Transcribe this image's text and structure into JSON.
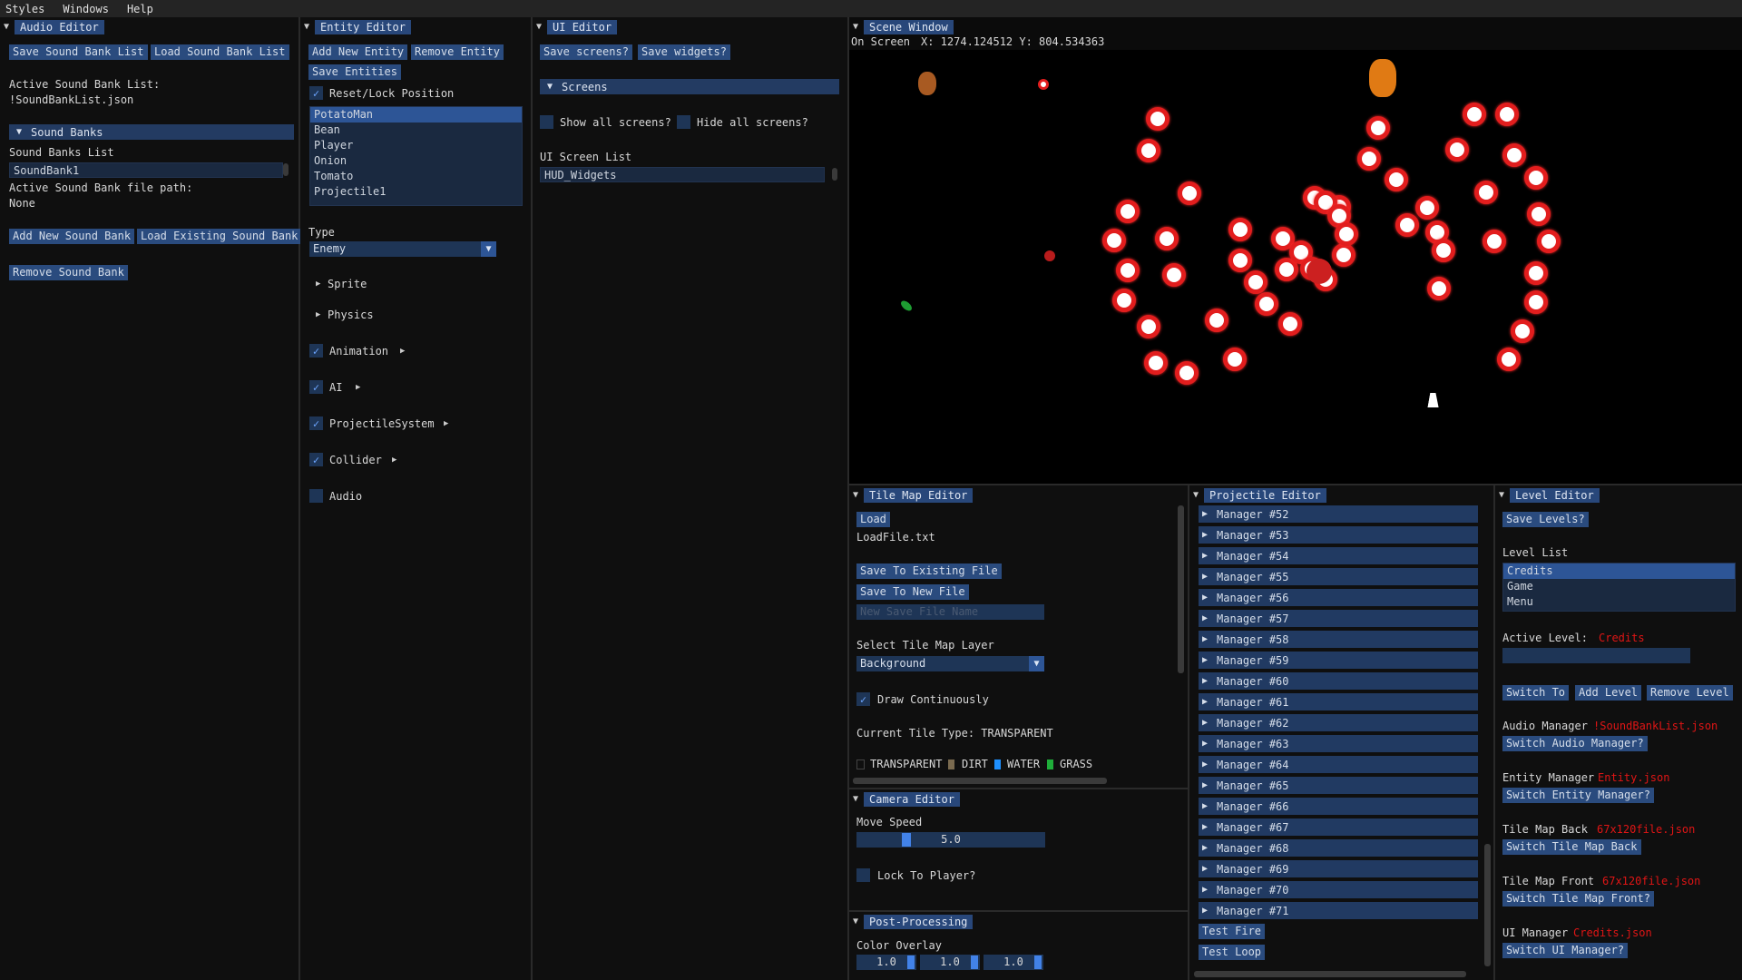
{
  "menubar": {
    "items": [
      "Styles",
      "Windows",
      "Help"
    ]
  },
  "audio_editor": {
    "title": "Audio Editor",
    "save_list": "Save Sound Bank List",
    "load_list": "Load Sound Bank List",
    "active_list_label": "Active Sound Bank List:",
    "active_list_value": "!SoundBankList.json",
    "sound_banks_header": "Sound Banks",
    "sound_banks_list_label": "Sound Banks List",
    "banks": [
      "SoundBank1"
    ],
    "file_path_label": "Active Sound Bank file path:",
    "file_path_value": "None",
    "add_new": "Add New Sound Bank",
    "load_existing": "Load Existing Sound Bank",
    "remove": "Remove Sound Bank"
  },
  "entity_editor": {
    "title": "Entity Editor",
    "add_new": "Add New Entity",
    "remove": "Remove Entity",
    "save": "Save Entities",
    "reset_lock": "Reset/Lock Position",
    "entities": [
      "PotatoMan",
      "Bean",
      "Player",
      "Onion",
      "Tomato",
      "Projectile1"
    ],
    "selected_entity": "PotatoMan",
    "type_label": "Type",
    "type_value": "Enemy",
    "sprite": "Sprite",
    "physics": "Physics",
    "animation": "Animation",
    "ai": "AI",
    "projectile_system": "ProjectileSystem",
    "collider": "Collider",
    "audio": "Audio"
  },
  "ui_editor": {
    "title": "UI Editor",
    "save_screens": "Save screens?",
    "save_widgets": "Save widgets?",
    "screens_header": "Screens",
    "show_all": "Show all screens?",
    "hide_all": "Hide all screens?",
    "screen_list_label": "UI Screen List",
    "screens": [
      "HUD_Widgets"
    ]
  },
  "scene_window": {
    "title": "Scene Window",
    "on_screen": "On Screen",
    "coords": "X: 1274.124512 Y: 804.534363"
  },
  "tile_map_editor": {
    "title": "Tile Map Editor",
    "load": "Load",
    "load_file": "LoadFile.txt",
    "save_existing": "Save To Existing File",
    "save_new": "Save To New File",
    "new_file_placeholder": "New Save File Name",
    "layer_label": "Select Tile Map Layer",
    "layer_value": "Background",
    "draw_continuously": "Draw Continuously",
    "current_tile_type": "Current Tile Type: TRANSPARENT",
    "tile_types": [
      {
        "label": "TRANSPARENT",
        "color": "#0f0f0f"
      },
      {
        "label": "DIRT",
        "color": "#7a6a4f"
      },
      {
        "label": "WATER",
        "color": "#1e90ff"
      },
      {
        "label": "GRASS",
        "color": "#1fae3a"
      }
    ]
  },
  "camera_editor": {
    "title": "Camera Editor",
    "move_speed_label": "Move Speed",
    "move_speed_value": "5.0",
    "move_speed_fraction": 0.25,
    "lock_to_player": "Lock To Player?"
  },
  "post_processing": {
    "title": "Post-Processing",
    "color_overlay_label": "Color Overlay",
    "values": [
      "1.0",
      "1.0",
      "1.0"
    ]
  },
  "projectile_editor": {
    "title": "Projectile Editor",
    "managers": [
      "Manager #52",
      "Manager #53",
      "Manager #54",
      "Manager #55",
      "Manager #56",
      "Manager #57",
      "Manager #58",
      "Manager #59",
      "Manager #60",
      "Manager #61",
      "Manager #62",
      "Manager #63",
      "Manager #64",
      "Manager #65",
      "Manager #66",
      "Manager #67",
      "Manager #68",
      "Manager #69",
      "Manager #70",
      "Manager #71"
    ],
    "test_fire": "Test Fire",
    "test_loop": "Test Loop"
  },
  "level_editor": {
    "title": "Level Editor",
    "save_levels": "Save Levels?",
    "level_list_label": "Level List",
    "levels": [
      "Credits",
      "Game",
      "Menu"
    ],
    "active_level_label": "Active Level:",
    "active_level_value": "Credits",
    "switch_to": "Switch To",
    "add_level": "Add Level",
    "remove_level": "Remove Level",
    "audio_manager_label": "Audio Manager",
    "audio_manager_value": "!SoundBankList.json",
    "switch_audio": "Switch Audio Manager?",
    "entity_manager_label": "Entity Manager",
    "entity_manager_value": "Entity.json",
    "switch_entity": "Switch Entity Manager?",
    "tilemap_back_label": "Tile Map Back",
    "tilemap_back_value": "67x120file.json",
    "switch_tilemap_back": "Switch Tile Map Back",
    "tilemap_front_label": "Tile Map Front",
    "tilemap_front_value": "67x120file.json",
    "switch_tilemap_front": "Switch Tile Map Front?",
    "ui_manager_label": "UI Manager",
    "ui_manager_value": "Credits.json",
    "switch_ui": "Switch UI Manager?"
  },
  "colors": {
    "accent": "#2a4b7e",
    "header": "#28477a",
    "highlight": "#e01515",
    "bullet_ring": "#e21d1d"
  }
}
